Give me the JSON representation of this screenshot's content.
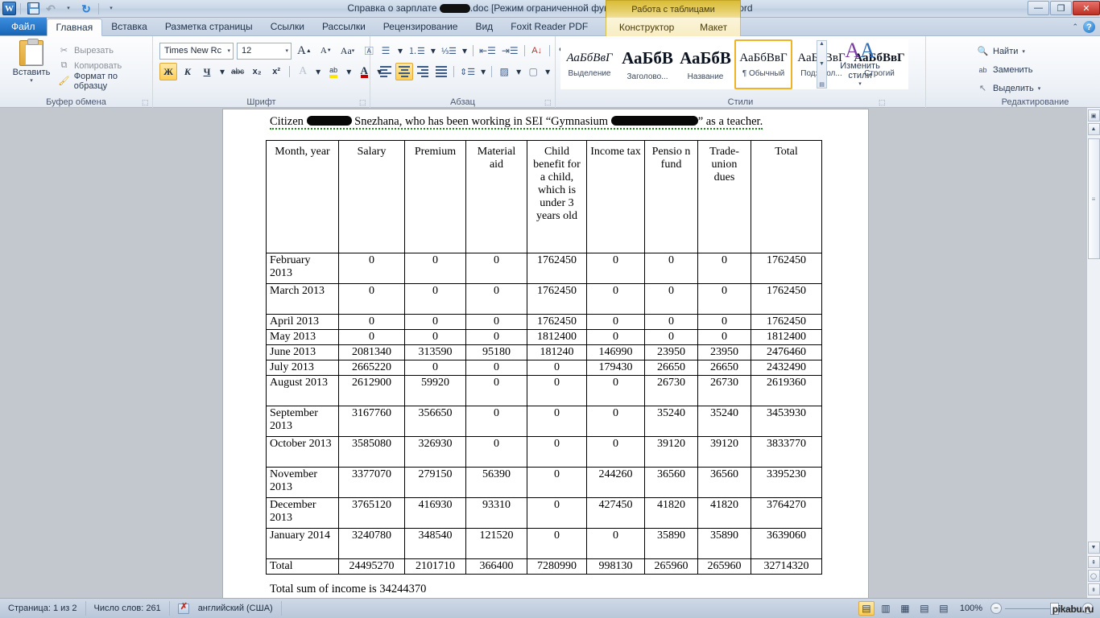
{
  "window": {
    "title_prefix": "Справка о зарплате ",
    "title_suffix": ".doc [Режим ограниченной функциональности] - Microsoft Word",
    "minimize": "—",
    "restore": "❐",
    "close": "✕"
  },
  "quick_access": {
    "word_logo": "W",
    "save": "save-icon",
    "undo": "↶",
    "undo_dropdown": "▾",
    "redo": "↻",
    "customize": "▾"
  },
  "tabs": {
    "file": "Файл",
    "items": [
      "Главная",
      "Вставка",
      "Разметка страницы",
      "Ссылки",
      "Рассылки",
      "Рецензирование",
      "Вид",
      "Foxit Reader PDF"
    ],
    "active": "Главная",
    "context_banner": "Работа с таблицами",
    "context_items": [
      "Конструктор",
      "Макет"
    ]
  },
  "ribbon": {
    "clipboard": {
      "group_label": "Буфер обмена",
      "paste": "Вставить",
      "paste_arrow": "▾",
      "cut": "Вырезать",
      "copy": "Копировать",
      "format_painter": "Формат по образцу",
      "launcher": "⬚"
    },
    "font": {
      "group_label": "Шрифт",
      "font_name": "Times New Rc",
      "font_size": "12",
      "grow_font": "A",
      "shrink_font": "A",
      "change_case": "Aa",
      "clear_formatting": "clear-format-icon",
      "bold": "Ж",
      "italic": "К",
      "underline": "Ч",
      "strikethrough": "abc",
      "subscript": "x₂",
      "superscript": "x²",
      "text_effects": "A",
      "highlight": "ab",
      "font_color": "A",
      "launcher": "⬚"
    },
    "paragraph": {
      "group_label": "Абзац",
      "bullets": "bullet-list-icon",
      "numbering": "numbered-list-icon",
      "multilevel": "multilevel-list-icon",
      "decrease_indent": "decrease-indent-icon",
      "increase_indent": "increase-indent-icon",
      "sort": "А↓",
      "show_marks": "¶",
      "align_left": "align-left-icon",
      "align_center": "align-center-icon",
      "align_right": "align-right-icon",
      "justify": "justify-icon",
      "line_spacing": "line-spacing-icon",
      "shading": "shading-icon",
      "borders": "borders-icon",
      "launcher": "⬚"
    },
    "styles": {
      "group_label": "Стили",
      "items": [
        {
          "sample": "АаБбВвГ",
          "name": "Выделение",
          "italic": true,
          "bold": false,
          "size": 15
        },
        {
          "sample": "АаБбВ",
          "name": "Заголово...",
          "italic": false,
          "bold": true,
          "size": 21
        },
        {
          "sample": "АаБбВ",
          "name": "Название",
          "italic": false,
          "bold": true,
          "size": 21
        },
        {
          "sample": "АаБбВвГ",
          "name": "¶ Обычный",
          "italic": false,
          "bold": false,
          "size": 15,
          "selected": true
        },
        {
          "sample": "АаБбВвГ",
          "name": "Подзагол...",
          "italic": false,
          "bold": false,
          "size": 15
        },
        {
          "sample": "АаБбВвГ",
          "name": "Строгий",
          "italic": false,
          "bold": true,
          "size": 15
        }
      ],
      "change_styles": "Изменить стили",
      "change_styles_arrow": "▾",
      "launcher": "⬚"
    },
    "editing": {
      "group_label": "Редактирование",
      "find": "Найти",
      "replace": "Заменить",
      "select": "Выделить",
      "arrow": "▾"
    }
  },
  "document": {
    "intro_before": "Citizen ",
    "intro_mid": " Snezhana, who has been working in SEI “Gymnasium ",
    "intro_after": "” as a teacher.",
    "footer": "Total sum of income is 34244370",
    "table": {
      "headers": [
        "Month, year",
        "Salary",
        "Premium",
        "Material aid",
        "Child benefit for a child, which is under 3 years old",
        "Income tax",
        "Pensio n fund",
        "Trade-union dues",
        "Total"
      ],
      "rows": [
        [
          "February 2013",
          "0",
          "0",
          "0",
          "1762450",
          "0",
          "0",
          "0",
          "1762450"
        ],
        [
          "March 2013",
          "0",
          "0",
          "0",
          "1762450",
          "0",
          "0",
          "0",
          "1762450"
        ],
        [
          "April 2013",
          "0",
          "0",
          "0",
          "1762450",
          "0",
          "0",
          "0",
          "1762450"
        ],
        [
          "May 2013",
          "0",
          "0",
          "0",
          "1812400",
          "0",
          "0",
          "0",
          "1812400"
        ],
        [
          "June 2013",
          "2081340",
          "313590",
          "95180",
          "181240",
          "146990",
          "23950",
          "23950",
          "2476460"
        ],
        [
          "July 2013",
          "2665220",
          "0",
          "0",
          "0",
          "179430",
          "26650",
          "26650",
          "2432490"
        ],
        [
          "August 2013",
          "2612900",
          "59920",
          "0",
          "0",
          "0",
          "26730",
          "26730",
          "2619360"
        ],
        [
          "September 2013",
          "3167760",
          "356650",
          "0",
          "0",
          "0",
          "35240",
          "35240",
          "3453930"
        ],
        [
          "October 2013",
          "3585080",
          "326930",
          "0",
          "0",
          "0",
          "39120",
          "39120",
          "3833770"
        ],
        [
          "November 2013",
          "3377070",
          "279150",
          "56390",
          "0",
          "244260",
          "36560",
          "36560",
          "3395230"
        ],
        [
          "December 2013",
          "3765120",
          "416930",
          "93310",
          "0",
          "427450",
          "41820",
          "41820",
          "3764270"
        ],
        [
          "January 2014",
          "3240780",
          "348540",
          "121520",
          "0",
          "0",
          "35890",
          "35890",
          "3639060"
        ],
        [
          "Total",
          "24495270",
          "2101710",
          "366400",
          "7280990",
          "998130",
          "265960",
          "265960",
          "32714320"
        ]
      ]
    }
  },
  "status_bar": {
    "page": "Страница: 1 из 2",
    "words": "Число слов: 261",
    "language": "английский (США)",
    "proof_icon": "proofing-errors-icon",
    "view_print": "print-layout-icon",
    "view_fullscreen": "fullscreen-reading-icon",
    "view_web": "web-layout-icon",
    "view_outline": "outline-icon",
    "view_draft": "draft-icon",
    "zoom": "100%",
    "zoom_out": "−",
    "zoom_in": "+",
    "watermark": "pikabu.ru"
  }
}
